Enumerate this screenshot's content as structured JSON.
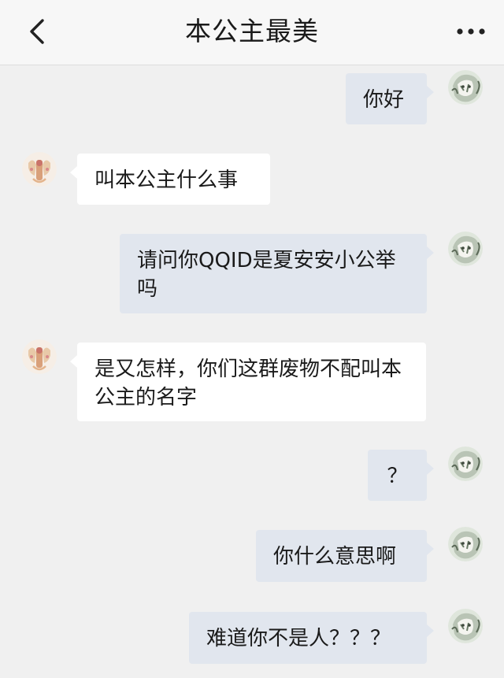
{
  "header": {
    "title": "本公主最美",
    "back_icon": "chevron-left-icon",
    "more_icon": "more-dots-icon"
  },
  "messages": [
    {
      "side": "out",
      "text": "你好"
    },
    {
      "side": "in",
      "text": "叫本公主什么事"
    },
    {
      "side": "out",
      "text": "请问你QQID是夏安安小公举吗"
    },
    {
      "side": "in",
      "text": "是又怎样，你们这群废物不配叫本公主的名字"
    },
    {
      "side": "out",
      "text": "？"
    },
    {
      "side": "out",
      "text": "你什么意思啊"
    },
    {
      "side": "out",
      "text": "难道你不是人？？？"
    }
  ],
  "colors": {
    "background": "#f0f0f0",
    "outgoing_bubble": "#e1e6ee",
    "incoming_bubble": "#ffffff",
    "text": "#1a1a1a"
  }
}
